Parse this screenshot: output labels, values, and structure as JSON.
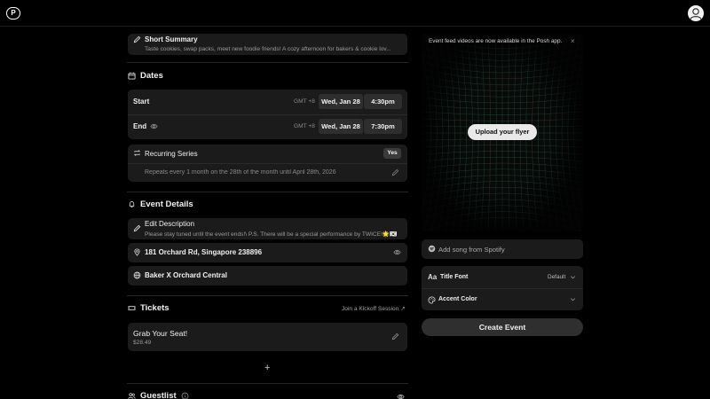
{
  "header": {
    "logo_text": "P",
    "avatar_icon": "user-icon"
  },
  "summary": {
    "label": "Short Summary",
    "value": "Taste cookies, swap packs, meet new foodie friends! A cozy afternoon for bakers & cookie lov..."
  },
  "dates": {
    "title": "Dates",
    "start": {
      "label": "Start",
      "tz": "GMT +8",
      "date": "Wed, Jan 28",
      "time": "4:30pm"
    },
    "end": {
      "label": "End",
      "tz": "GMT +8",
      "date": "Wed, Jan 28",
      "time": "7:30pm"
    },
    "recurring": {
      "label": "Recurring Series",
      "toggle": "Yes",
      "description": "Repeats every 1 month on the 28th of the month until April 28th, 2026"
    }
  },
  "event_details": {
    "title": "Event Details",
    "description_label": "Edit Description",
    "description_value": "Please stay tuned until the event ends!\\ P.S. There will be a special performance by TWICE!🌟🇰🇷",
    "address": "181 Orchard Rd, Singapore 238896",
    "venue": "Baker X Orchard Central"
  },
  "tickets": {
    "title": "Tickets",
    "link": "Join a Kickoff Session",
    "ticket_name": "Grab Your Seat!",
    "ticket_price": "$28.49",
    "add_symbol": "+"
  },
  "guestlist": {
    "title": "Guestlist"
  },
  "flyer": {
    "banner": "Event feed videos are now available in the Posh app.",
    "upload_label": "Upload your flyer"
  },
  "music": {
    "placeholder": "Add song from Spotify"
  },
  "style": {
    "title_font_label": "Title Font",
    "title_font_value": "Default",
    "title_font_icon_text": "Aa",
    "accent_label": "Accent Color"
  },
  "create_label": "Create Event",
  "colors": {
    "background": "#000000",
    "card": "#1b1b1b",
    "pill": "#2e2e2e",
    "grid": "#2c8a5c",
    "button": "#2f2f2f"
  }
}
